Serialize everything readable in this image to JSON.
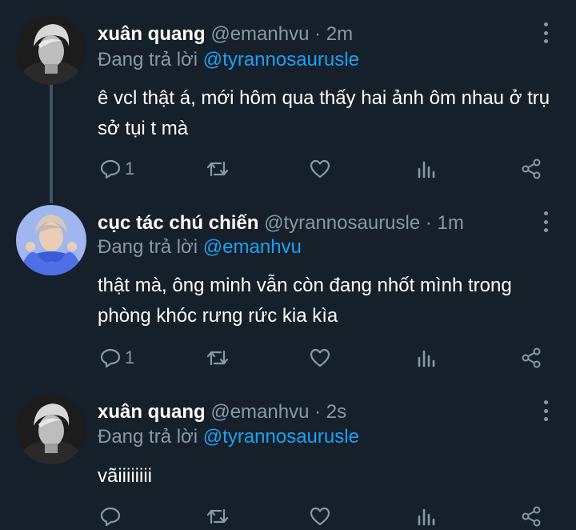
{
  "tweets": [
    {
      "name": "xuân quang",
      "handle": "@emanhvu",
      "time": "2m",
      "replying_label": "Đang trả lời",
      "replying_to": "@tyrannosaurusle",
      "text": "ê vcl thật á, mới hôm qua thấy hai ảnh ôm nhau ở trụ sở tụi t mà",
      "reply_count": "1"
    },
    {
      "name": "cục tác chú chiến",
      "handle": "@tyrannosaurusle",
      "time": "1m",
      "replying_label": "Đang trả lời",
      "replying_to": "@emanhvu",
      "text": "thật mà, ông minh vẫn còn đang nhốt mình trong phòng khóc rưng rức kia kìa",
      "reply_count": "1"
    },
    {
      "name": "xuân quang",
      "handle": "@emanhvu",
      "time": "2s",
      "replying_label": "Đang trả lời",
      "replying_to": "@tyrannosaurusle",
      "text": "vãiiiiiiii",
      "reply_count": ""
    }
  ],
  "separator": " · ",
  "colors": {
    "background": "#15202b",
    "secondary_text": "#8899a6",
    "link": "#1da1f2",
    "thread_line": "#3d5466"
  },
  "icons": {
    "reply": "reply-icon",
    "retweet": "retweet-icon",
    "like": "heart-icon",
    "analytics": "analytics-icon",
    "share": "share-icon",
    "more": "more-vertical-icon"
  }
}
